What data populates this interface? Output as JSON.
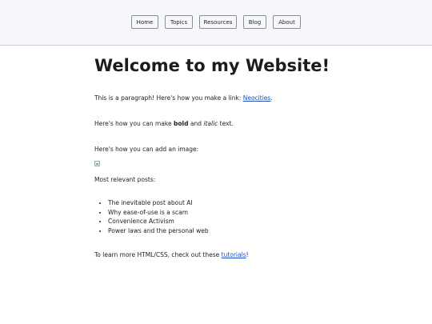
{
  "nav": {
    "items": [
      "Home",
      "Topics",
      "Resources",
      "Blog",
      "About"
    ]
  },
  "main": {
    "title": "Welcome to my Website!",
    "p1": {
      "text": "This is a paragraph! Here's how you make a link: ",
      "link": "Neocities",
      "after": "."
    },
    "p2": {
      "before": "Here's how you can make ",
      "bold": "bold",
      "middle": " and ",
      "italic": "italic",
      "after": " text."
    },
    "p3": {
      "text": "Here's how you can add an image:"
    },
    "image": {
      "icon": "broken-image-icon"
    },
    "p4": {
      "text": "Most relevant posts:"
    },
    "posts": [
      "The inevitable post about AI",
      "Why ease-of-use is a scam",
      "Convenience Activism",
      "Power laws and the personal web"
    ],
    "p5": {
      "text": "To learn more HTML/CSS, check out these ",
      "link": "tutorials",
      "after": "!"
    }
  },
  "colors": {
    "header_bg": "#f5f7fb",
    "link": "#1f4fb8",
    "text": "#222222"
  }
}
